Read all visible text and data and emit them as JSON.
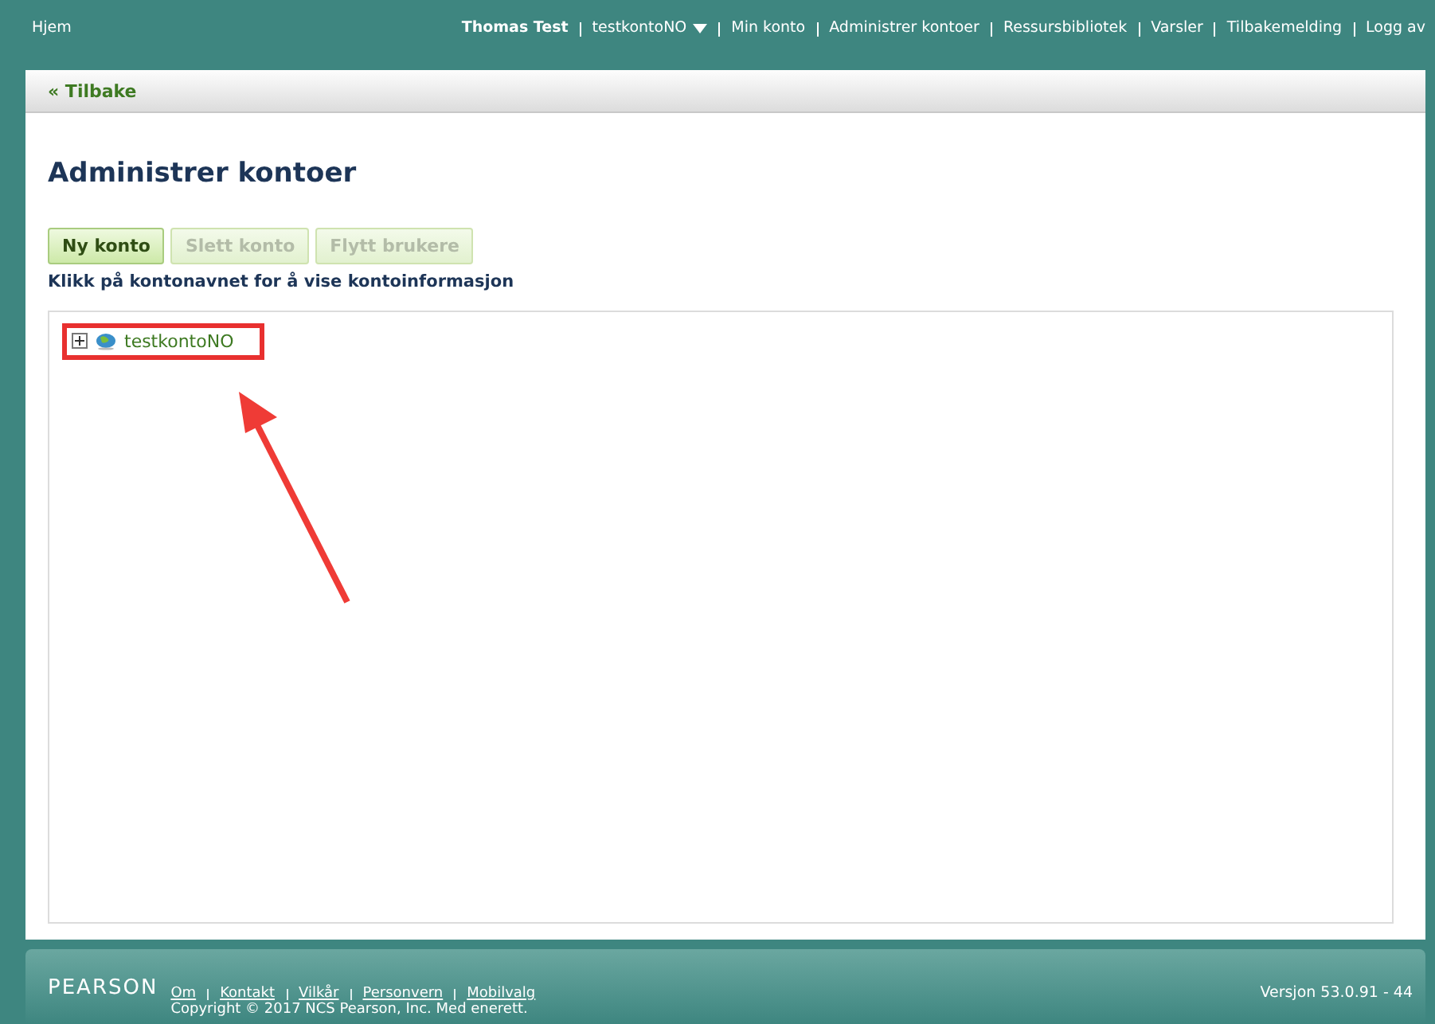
{
  "top_bar": {
    "home": "Hjem",
    "user": "Thomas Test",
    "account_menu": "testkontoNO",
    "links": [
      "Min konto",
      "Administrer kontoer",
      "Ressursbibliotek",
      "Varsler",
      "Tilbakemelding",
      "Logg av"
    ]
  },
  "back_link": "« Tilbake",
  "page_title": "Administrer kontoer",
  "buttons": [
    {
      "label": "Ny konto",
      "disabled": false
    },
    {
      "label": "Slett konto",
      "disabled": true
    },
    {
      "label": "Flytt brukere",
      "disabled": true
    }
  ],
  "hint": "Klikk på kontonavnet for å vise kontoinformasjon",
  "tree": [
    {
      "label": "testkontoNO",
      "expanded": false,
      "highlighted": true
    }
  ],
  "footer": {
    "logo": "PEARSON",
    "links": [
      "Om",
      "Kontakt",
      "Vilkår",
      "Personvern",
      "Mobilvalg"
    ],
    "copyright": "Copyright © 2017 NCS Pearson, Inc. Med enerett.",
    "version": "Versjon 53.0.91 - 44"
  }
}
